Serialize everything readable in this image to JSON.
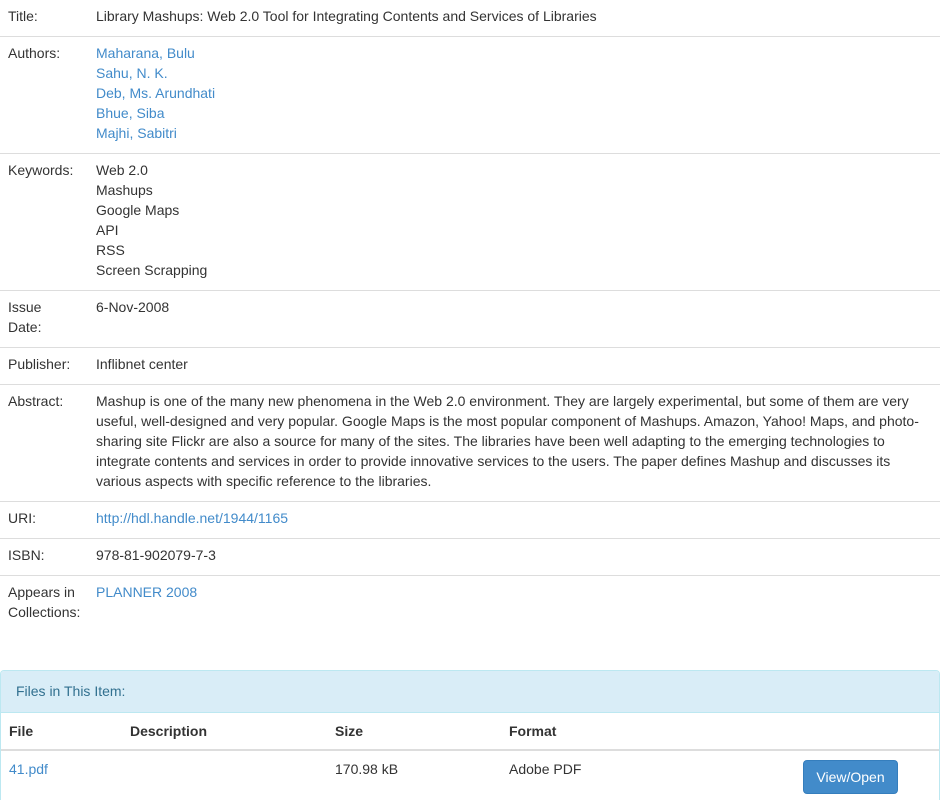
{
  "metadata": {
    "title": {
      "label": "Title:",
      "value": "Library Mashups: Web 2.0 Tool for Integrating Contents and Services of Libraries"
    },
    "authors": {
      "label": "Authors:",
      "items": [
        "Maharana, Bulu",
        "Sahu, N. K.",
        "Deb, Ms. Arundhati",
        "Bhue, Siba",
        "Majhi, Sabitri"
      ]
    },
    "keywords": {
      "label": "Keywords:",
      "items": [
        "Web 2.0",
        "Mashups",
        "Google Maps",
        "API",
        "RSS",
        "Screen Scrapping"
      ]
    },
    "issue_date": {
      "label_line1": "Issue",
      "label_line2": "Date:",
      "value": "6-Nov-2008"
    },
    "publisher": {
      "label": "Publisher:",
      "value": "Inflibnet center"
    },
    "abstract": {
      "label": "Abstract:",
      "value": "Mashup is one of the many new phenomena in the Web 2.0 environment. They are largely experimental, but some of them are very useful, well-designed and very popular. Google Maps is the most popular component of Mashups. Amazon, Yahoo! Maps, and photo-sharing site Flickr are also a source for many of the sites. The libraries have been well adapting to the emerging technologies to integrate contents and services in order to provide innovative services to the users. The paper defines Mashup and discusses its various aspects with specific reference to the libraries."
    },
    "uri": {
      "label": "URI:",
      "value": "http://hdl.handle.net/1944/1165"
    },
    "isbn": {
      "label": "ISBN:",
      "value": "978-81-902079-7-3"
    },
    "collections": {
      "label_line1": "Appears in",
      "label_line2": "Collections:",
      "value": "PLANNER 2008"
    }
  },
  "files": {
    "heading": "Files in This Item:",
    "columns": {
      "file": "File",
      "description": "Description",
      "size": "Size",
      "format": "Format"
    },
    "rows": [
      {
        "file": "41.pdf",
        "description": "",
        "size": "170.98 kB",
        "format": "Adobe PDF",
        "action": "View/Open"
      }
    ]
  },
  "colors": {
    "link": "#428bca",
    "panel_heading_bg": "#d9edf7",
    "panel_heading_text": "#31708f",
    "button_bg": "#428bca"
  }
}
